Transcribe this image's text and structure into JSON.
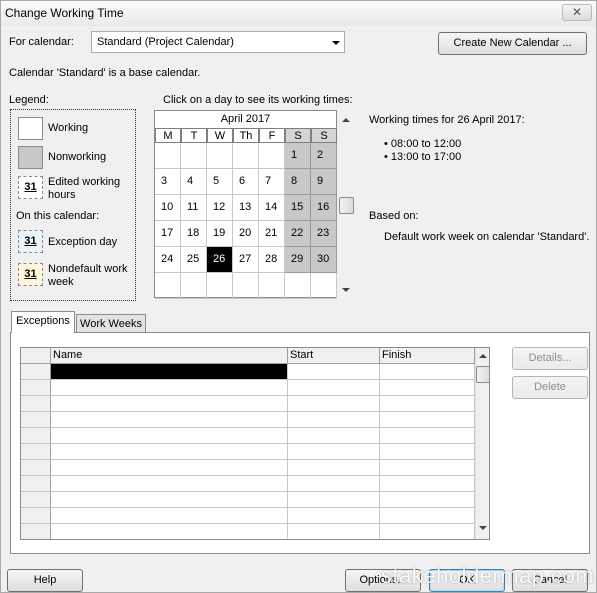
{
  "window": {
    "title": "Change Working Time",
    "close_glyph": "✕"
  },
  "for_calendar": {
    "label": "For calendar:",
    "value": "Standard (Project Calendar)"
  },
  "create_calendar_button": "Create New Calendar ...",
  "base_calendar_note": "Calendar 'Standard' is a base calendar.",
  "legend": {
    "title": "Legend:",
    "working": "Working",
    "nonworking": "Nonworking",
    "edited_working_hours": "Edited working hours",
    "on_this_calendar": "On this calendar:",
    "exception_day": "Exception day",
    "nondefault_work_week": "Nondefault work week",
    "swatch_number": "31"
  },
  "calendar": {
    "instruction": "Click on a day to see its working times:",
    "month": "April 2017",
    "weekdays": [
      "M",
      "T",
      "W",
      "Th",
      "F",
      "S",
      "S"
    ],
    "weeks": [
      [
        "",
        "",
        "",
        "",
        "",
        "1",
        "2"
      ],
      [
        "3",
        "4",
        "5",
        "6",
        "7",
        "8",
        "9"
      ],
      [
        "10",
        "11",
        "12",
        "13",
        "14",
        "15",
        "16"
      ],
      [
        "17",
        "18",
        "19",
        "20",
        "21",
        "22",
        "23"
      ],
      [
        "24",
        "25",
        "26",
        "27",
        "28",
        "29",
        "30"
      ],
      [
        "",
        "",
        "",
        "",
        "",
        "",
        ""
      ]
    ],
    "selected_day": "26"
  },
  "working_times": {
    "title": "Working times for 26 April 2017:",
    "times": [
      "08:00 to 12:00",
      "13:00 to 17:00"
    ],
    "based_on_label": "Based on:",
    "based_on_value": "Default work week on calendar 'Standard'."
  },
  "tabs": {
    "exceptions": "Exceptions",
    "work_weeks": "Work Weeks"
  },
  "grid": {
    "columns": [
      "Name",
      "Start",
      "Finish"
    ],
    "row_count": 11
  },
  "side_buttons": {
    "details": "Details...",
    "delete": "Delete"
  },
  "footer": {
    "help": "Help",
    "options": "Options...",
    "ok": "OK",
    "cancel": "Cancel"
  },
  "watermark": "stakeholdermap.com",
  "colors": {
    "nonworking_gray": "#c8c8c8",
    "exception_fill": "#e8f4f8",
    "nondefault_fill": "#fdf6dc",
    "selected": "#000000"
  }
}
